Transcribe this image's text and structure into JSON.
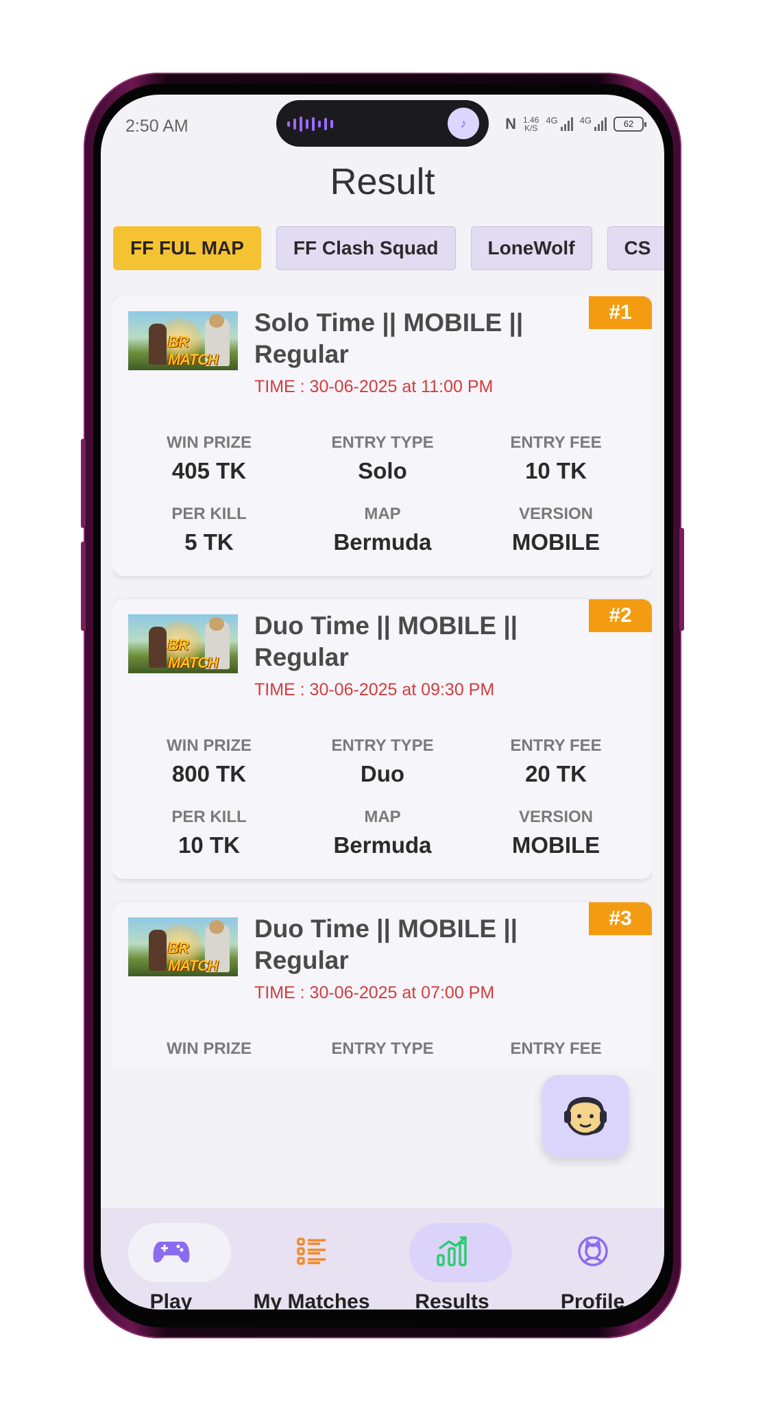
{
  "status_bar": {
    "time": "2:50 AM",
    "speed": "1.46",
    "speed_unit": "K/S",
    "network1": "4G",
    "network2": "4G",
    "battery": "62"
  },
  "page": {
    "title": "Result"
  },
  "tabs": [
    {
      "label": "FF FUL MAP",
      "active": true
    },
    {
      "label": "FF Clash Squad",
      "active": false
    },
    {
      "label": "LoneWolf",
      "active": false
    },
    {
      "label": "CS",
      "active": false
    }
  ],
  "thumbnail_text": "BR MATCH",
  "matches": [
    {
      "rank": "#1",
      "title": "Solo Time || MOBILE || Regular",
      "time": "TIME : 30-06-2025 at 11:00 PM",
      "stats": [
        {
          "label": "WIN PRIZE",
          "value": "405 TK"
        },
        {
          "label": "ENTRY TYPE",
          "value": "Solo"
        },
        {
          "label": "ENTRY FEE",
          "value": "10 TK"
        },
        {
          "label": "PER KILL",
          "value": "5 TK"
        },
        {
          "label": "MAP",
          "value": "Bermuda"
        },
        {
          "label": "VERSION",
          "value": "MOBILE"
        }
      ]
    },
    {
      "rank": "#2",
      "title": "Duo Time || MOBILE || Regular",
      "time": "TIME : 30-06-2025 at 09:30 PM",
      "stats": [
        {
          "label": "WIN PRIZE",
          "value": "800 TK"
        },
        {
          "label": "ENTRY TYPE",
          "value": "Duo"
        },
        {
          "label": "ENTRY FEE",
          "value": "20 TK"
        },
        {
          "label": "PER KILL",
          "value": "10 TK"
        },
        {
          "label": "MAP",
          "value": "Bermuda"
        },
        {
          "label": "VERSION",
          "value": "MOBILE"
        }
      ]
    },
    {
      "rank": "#3",
      "title": "Duo Time || MOBILE || Regular",
      "time": "TIME : 30-06-2025 at 07:00 PM",
      "stats": [
        {
          "label": "WIN PRIZE",
          "value": ""
        },
        {
          "label": "ENTRY TYPE",
          "value": ""
        },
        {
          "label": "ENTRY FEE",
          "value": ""
        }
      ]
    }
  ],
  "bottom_nav": [
    {
      "label": "Play",
      "icon": "gamepad-icon",
      "active": false,
      "color": "#8b6cf0"
    },
    {
      "label": "My Matches",
      "icon": "list-icon",
      "active": false,
      "color": "#f08a2c"
    },
    {
      "label": "Results",
      "icon": "chart-icon",
      "active": true,
      "color": "#2ecc71"
    },
    {
      "label": "Profile",
      "icon": "avatar-icon",
      "active": false,
      "color": "#8b6cf0"
    }
  ],
  "colors": {
    "accent": "#f5c234",
    "rank_badge": "#f39c12",
    "time_text": "#d23c3c",
    "results_pill": "#dcd3fa"
  }
}
